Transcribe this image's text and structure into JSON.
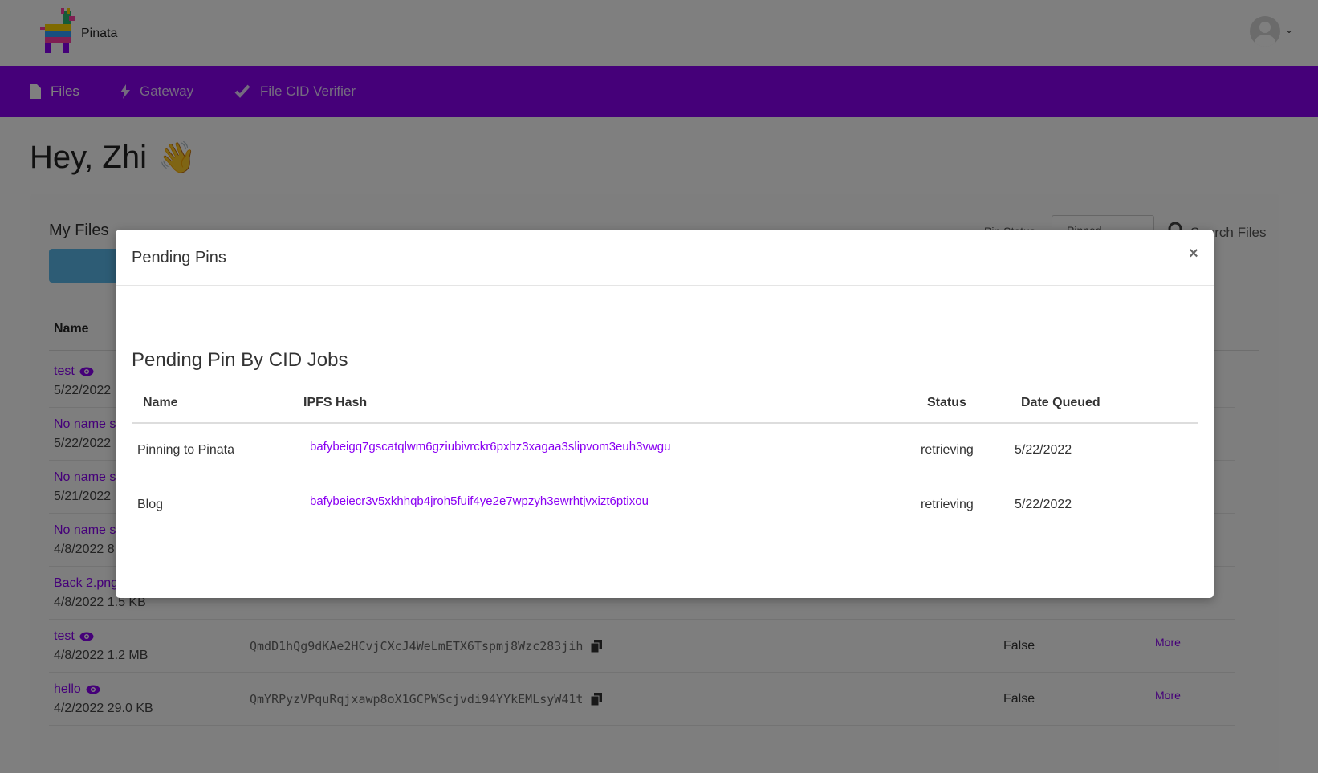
{
  "app": {
    "name": "Pinata"
  },
  "nav": {
    "items": [
      {
        "label": "Files",
        "icon": "file-icon",
        "active": true
      },
      {
        "label": "Gateway",
        "icon": "bolt-icon",
        "active": false
      },
      {
        "label": "File CID Verifier",
        "icon": "check-badge-icon",
        "active": false
      }
    ]
  },
  "greeting": {
    "text": "Hey, Zhi",
    "emoji": "👋"
  },
  "files_panel": {
    "title": "My Files",
    "pin_status_label": "Pin Status",
    "pin_status_value": "Pinned",
    "search_label": "Search Files",
    "column_name": "Name",
    "rows": [
      {
        "name": "test",
        "meta": "5/22/2022",
        "hash": "",
        "col": "",
        "more": ""
      },
      {
        "name": "No name s",
        "meta": "5/22/2022",
        "hash": "",
        "col": "",
        "more": ""
      },
      {
        "name": "No name s",
        "meta": "5/21/2022",
        "hash": "",
        "col": "",
        "more": ""
      },
      {
        "name": "No name s",
        "meta": "4/8/2022 8",
        "hash": "",
        "col": "",
        "more": ""
      },
      {
        "name": "Back 2.png",
        "meta": "4/8/2022 1.5 KB",
        "hash": "",
        "col": "",
        "more": ""
      },
      {
        "name": "test",
        "meta": "4/8/2022 1.2 MB",
        "hash": "QmdD1hQg9dKAe2HCvjCXcJ4WeLmETX6Tspmj8Wzc283jih",
        "col": "False",
        "more": "More"
      },
      {
        "name": "hello",
        "meta": "4/2/2022 29.0 KB",
        "hash": "QmYRPyzVPquRqjxawp8oX1GCPWScjvdi94YYkEMLsyW41t",
        "col": "False",
        "more": "More"
      }
    ]
  },
  "modal": {
    "title": "Pending Pins",
    "close_label": "×",
    "section_title": "Pending Pin By CID Jobs",
    "columns": {
      "name": "Name",
      "hash": "IPFS Hash",
      "status": "Status",
      "date": "Date Queued"
    },
    "jobs": [
      {
        "name": "Pinning to Pinata",
        "hash": "bafybeigq7gscatqlwm6gziubivrckr6pxhz3xagaa3slipvom3euh3vwgu",
        "status": "retrieving",
        "date": "5/22/2022"
      },
      {
        "name": "Blog",
        "hash": "bafybeiecr3v5xkhhqb4jroh5fuif4ye2e7wpzyh3ewrhtjvxizt6ptixou",
        "status": "retrieving",
        "date": "5/22/2022"
      }
    ]
  },
  "colors": {
    "brand_purple": "#8a00f2",
    "overlay": "rgba(0,0,0,0.5)",
    "upload_blue": "#5ab9ea"
  }
}
